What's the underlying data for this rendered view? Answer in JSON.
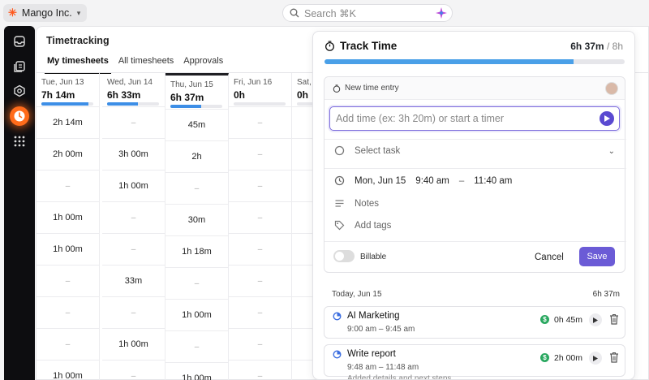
{
  "topbar": {
    "workspace_name": "Mango Inc.",
    "search_placeholder": "Search ⌘K"
  },
  "rail": {
    "items": [
      {
        "icon": "inbox-icon"
      },
      {
        "icon": "docs-icon"
      },
      {
        "icon": "gear-hub-icon"
      },
      {
        "icon": "clock-icon",
        "active": true
      },
      {
        "icon": "apps-grid-icon"
      }
    ],
    "active_color": "#ff6b1a"
  },
  "timetracking": {
    "title": "Timetracking",
    "tabs": [
      {
        "label": "My timesheets",
        "active": true
      },
      {
        "label": "All timesheets"
      },
      {
        "label": "Approvals"
      }
    ],
    "days": [
      {
        "label": "Tue, Jun 13",
        "total": "7h 14m",
        "progress": 0.9,
        "cells": [
          "2h 14m",
          "2h 00m",
          "–",
          "1h 00m",
          "1h 00m",
          "–",
          "–",
          "–",
          "1h 00m"
        ]
      },
      {
        "label": "Wed, Jun 14",
        "total": "6h 33m",
        "progress": 0.6,
        "cells": [
          "–",
          "3h 00m",
          "1h 00m",
          "–",
          "–",
          "33m",
          "–",
          "1h 00m",
          "–"
        ]
      },
      {
        "label": "Thu, Jun 15",
        "total": "6h 37m",
        "progress": 0.6,
        "today": true,
        "cells": [
          "45m",
          "2h",
          "–",
          "30m",
          "1h 18m",
          "–",
          "1h 00m",
          "–",
          "1h 00m"
        ]
      },
      {
        "label": "Fri, Jun 16",
        "total": "0h",
        "progress": 0,
        "cells": [
          "–",
          "–",
          "–",
          "–",
          "–",
          "–",
          "–",
          "–",
          "–"
        ]
      },
      {
        "label": "Sat, J",
        "total": "0h",
        "progress": 0,
        "cells": [
          "–",
          "–",
          "–",
          "–",
          "–",
          "–",
          "–",
          "–",
          "–"
        ]
      }
    ]
  },
  "track_panel": {
    "title": "Track Time",
    "total_tracked": "6h 37m",
    "total_separator": "/",
    "total_target": "8h",
    "progress": 0.83,
    "new_entry_label": "New time entry",
    "add_time_placeholder": "Add time (ex: 3h 20m) or start a timer",
    "select_task_label": "Select task",
    "date": "Mon, Jun 15",
    "start_time": "9:40 am",
    "time_dash": "–",
    "end_time": "11:40 am",
    "notes_label": "Notes",
    "tags_label": "Add tags",
    "billable_label": "Billable",
    "cancel_label": "Cancel",
    "save_label": "Save",
    "accent": "#6b5bd6"
  },
  "log": {
    "day_label": "Today, Jun 15",
    "day_total": "6h 37m",
    "entries": [
      {
        "name": "AI Marketing",
        "time": "9:00 am – 9:45 am",
        "duration": "0h 45m",
        "money_symbol": "$",
        "description": ""
      },
      {
        "name": "Write report",
        "time": "9:48 am – 11:48 am",
        "duration": "2h 00m",
        "money_symbol": "$",
        "description": "Added details and next steps"
      }
    ]
  }
}
